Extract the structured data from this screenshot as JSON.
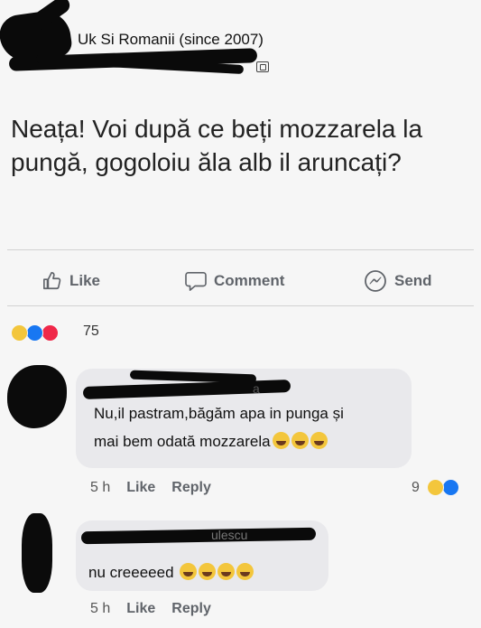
{
  "post": {
    "group_name": "Uk Si Romanii (since 2007)",
    "text": "Neața! Voi după ce beți mozzarela la pungă, gogoloiu ăla alb il aruncați?",
    "actions": {
      "like": "Like",
      "comment": "Comment",
      "send": "Send"
    },
    "reactions": {
      "icons": [
        "haha-icon",
        "like-icon",
        "love-icon"
      ],
      "count": "75"
    }
  },
  "comments": [
    {
      "author_visible": "a",
      "text_line1": "Nu,il pastram,băgăm apa in punga și",
      "text_line2": "mai bem odată mozzarela",
      "time": "5 h",
      "like_label": "Like",
      "reply_label": "Reply",
      "reaction_count": "9"
    },
    {
      "author_visible": "ulescu",
      "text": "nu creeeeed",
      "time": "5 h",
      "like_label": "Like",
      "reply_label": "Reply"
    }
  ],
  "colors": {
    "background": "#f6f6f6",
    "bubble": "#e9e9ec",
    "like_blue": "#1877f2",
    "love_red": "#f02849",
    "haha_yellow": "#f3c63c"
  }
}
